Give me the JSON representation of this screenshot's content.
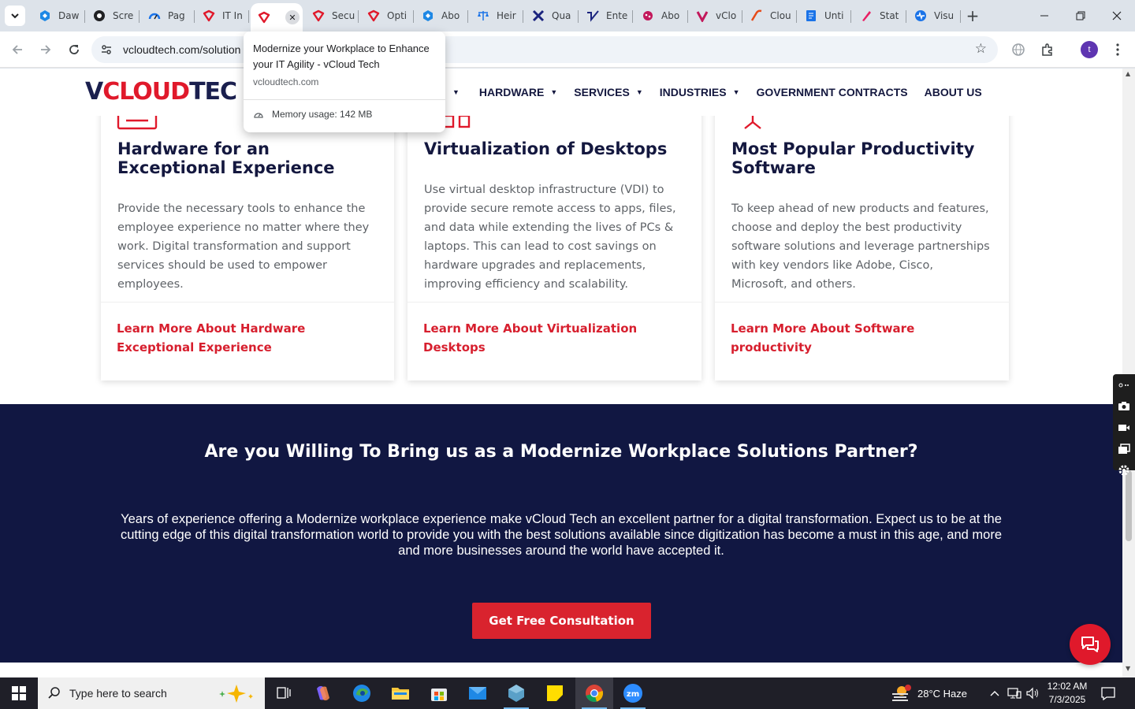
{
  "browser": {
    "tabs": [
      {
        "label": "Daw",
        "icon": "hexagon-icon",
        "color": "#1e88e5"
      },
      {
        "label": "Scre",
        "icon": "screencast-icon",
        "color": "#202124"
      },
      {
        "label": "Pag",
        "icon": "speedometer-icon",
        "color": "#1a73e8"
      },
      {
        "label": "IT In",
        "icon": "vcloud-logo-icon",
        "color": "#e0192b"
      },
      {
        "label": "",
        "icon": "vcloud-logo-icon",
        "color": "#e0192b",
        "active": true
      },
      {
        "label": "Secu",
        "icon": "vcloud-logo-icon",
        "color": "#e0192b"
      },
      {
        "label": "Opti",
        "icon": "vcloud-logo-icon",
        "color": "#e0192b"
      },
      {
        "label": "Abo",
        "icon": "hexagon-icon",
        "color": "#1e88e5"
      },
      {
        "label": "Heir",
        "icon": "scales-icon",
        "color": "#1a73e8"
      },
      {
        "label": "Qua",
        "icon": "x-logo-icon",
        "color": "#1a237e"
      },
      {
        "label": "Ente",
        "icon": "checkmark-icon",
        "color": "#1a237e"
      },
      {
        "label": "Abo",
        "icon": "dots-icon",
        "color": "#c2185b"
      },
      {
        "label": "vClo",
        "icon": "v-logo-icon",
        "color": "#c2185b"
      },
      {
        "label": "Clou",
        "icon": "slash-logo-icon",
        "color": "#e64a19"
      },
      {
        "label": "Unti",
        "icon": "docs-icon",
        "color": "#1a73e8"
      },
      {
        "label": "Stat",
        "icon": "pen-icon",
        "color": "#e91e63"
      },
      {
        "label": "Visu",
        "icon": "activity-icon",
        "color": "#1a73e8"
      }
    ],
    "url": "vcloudtech.com/solution"
  },
  "hovercard": {
    "title": "Modernize your Workplace to Enhance your IT Agility - vCloud Tech",
    "domain": "vcloudtech.com",
    "memory": "Memory usage: 142 MB"
  },
  "site": {
    "logo": {
      "v": "V",
      "cloud": "CLOUD",
      "tech": "TEC"
    },
    "nav": [
      {
        "label": "",
        "has_caret": true
      },
      {
        "label": "HARDWARE",
        "has_caret": true
      },
      {
        "label": "SERVICES",
        "has_caret": true
      },
      {
        "label": "INDUSTRIES",
        "has_caret": true
      },
      {
        "label": "GOVERNMENT CONTRACTS",
        "has_caret": false
      },
      {
        "label": "ABOUT US",
        "has_caret": false
      }
    ],
    "cards": [
      {
        "title": "Hardware for an Exceptional Experience",
        "body": "Provide the necessary tools to enhance the employee experience no matter where they work. Digital transformation and support services should be used to empower employees.",
        "link": "Learn More About Hardware Exceptional Experience",
        "icon": "hardware-icon"
      },
      {
        "title": "Virtualization of Desktops",
        "body": "Use virtual desktop infrastructure (VDI) to provide secure remote access to apps, files, and data while extending the lives of PCs & laptops. This can lead to cost savings on hardware upgrades and replacements, improving efficiency and scalability.",
        "link": "Learn More About Virtualization Desktops",
        "icon": "network-desktops-icon"
      },
      {
        "title": "Most Popular Productivity Software",
        "body": "To keep ahead of new products and features, choose and deploy the best productivity software solutions and leverage partnerships with key vendors like Adobe, Cisco, Microsoft, and others.",
        "link": "Learn More About Software productivity",
        "icon": "presentation-icon"
      }
    ],
    "cta": {
      "heading": "Are you Willing To Bring us as a Modernize Workplace Solutions Partner?",
      "body": "Years of experience offering a Modernize workplace experience make vCloud Tech an excellent partner for a digital transformation. Expect us to be at the cutting edge of this digital transformation world to provide you with the best solutions available since digitization has become a must in this age, and more and more businesses around the world have accepted it.",
      "button": "Get Free Consultation"
    }
  },
  "taskbar": {
    "search_placeholder": "Type here to search",
    "weather": "28°C  Haze",
    "time": "12:02 AM",
    "date": "7/3/2025",
    "profile_initial": "t"
  },
  "colors": {
    "brand_red": "#e0192b",
    "brand_navy": "#111742",
    "link_red": "#d71f2e"
  }
}
